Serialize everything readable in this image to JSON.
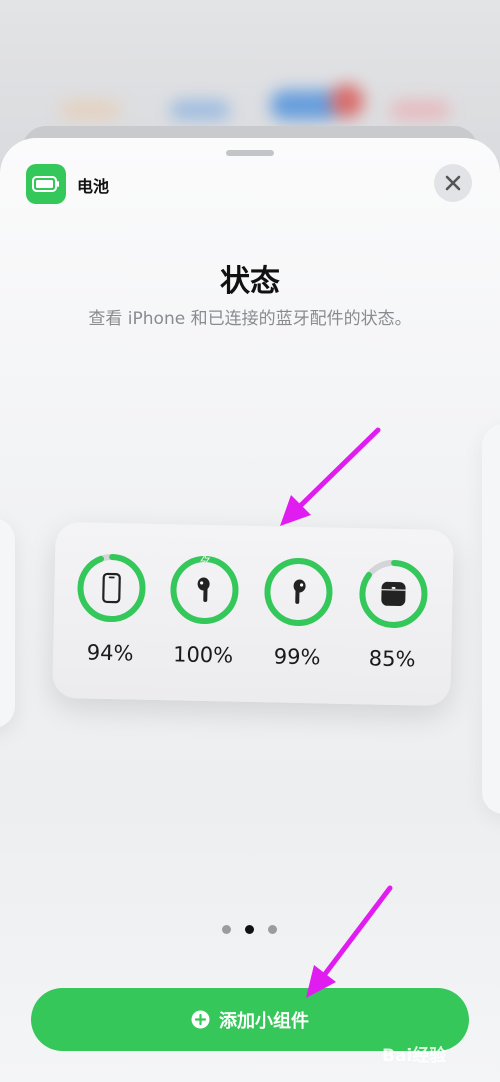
{
  "header": {
    "app_name": "电池",
    "close_icon": "close-icon",
    "app_icon": "battery-icon"
  },
  "content": {
    "title": "状态",
    "subtitle": "查看 iPhone 和已连接的蓝牙配件的状态。"
  },
  "widget": {
    "devices": [
      {
        "icon": "iphone-icon",
        "label": "94%",
        "level": 0.94,
        "charging": false
      },
      {
        "icon": "airpod-icon",
        "label": "100%",
        "level": 1.0,
        "charging": true
      },
      {
        "icon": "airpod-icon",
        "label": "99%",
        "level": 0.99,
        "charging": false
      },
      {
        "icon": "airpods-case-icon",
        "label": "85%",
        "level": 0.85,
        "charging": false
      }
    ]
  },
  "pagination": {
    "count": 3,
    "active": 1
  },
  "footer": {
    "add_label": "添加小组件"
  },
  "colors": {
    "accent": "#34c759",
    "track": "#d4d5d8",
    "arrow": "#e11cf0"
  },
  "watermark": {
    "text": "Bai经验"
  }
}
